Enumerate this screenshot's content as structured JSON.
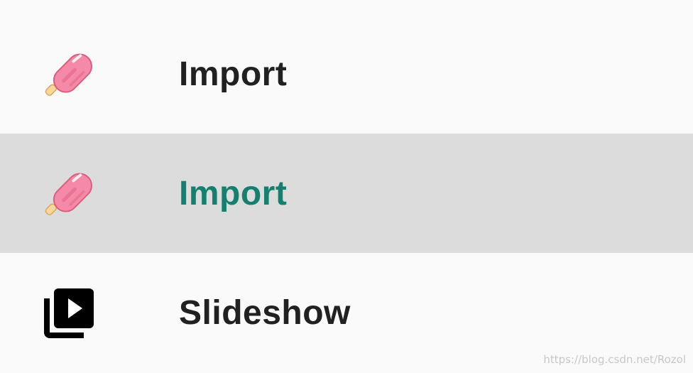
{
  "menu": {
    "items": [
      {
        "label": "Import",
        "icon": "popsicle-icon",
        "checked": false
      },
      {
        "label": "Import",
        "icon": "popsicle-icon",
        "checked": true
      },
      {
        "label": "Slideshow",
        "icon": "slideshow-icon",
        "checked": false
      }
    ]
  },
  "colors": {
    "background": "#fafafa",
    "highlight": "#dcdcdc",
    "text": "#212121",
    "checked_text": "#15806f",
    "popsicle_pink": "#f48aa7",
    "popsicle_stick": "#f7d79a"
  },
  "watermark": "https://blog.csdn.net/Rozol"
}
